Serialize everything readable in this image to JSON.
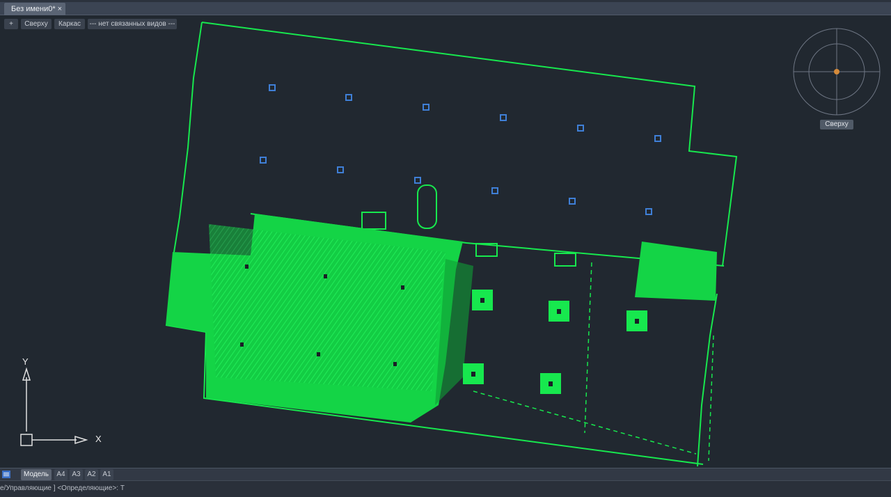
{
  "app": {
    "document_tab": {
      "title": "Без имени0*",
      "close_glyph": "×"
    }
  },
  "viewport": {
    "controls": {
      "menu_glyph": "+",
      "view": "Сверху",
      "visual_style": "Каркас",
      "named_views": "--- нет связанных видов ---"
    },
    "navigation_cube": {
      "label": "Сверху"
    },
    "ucs": {
      "x_label": "X",
      "y_label": "Y"
    }
  },
  "layout_tabs": [
    {
      "label": "Модель",
      "active": true
    },
    {
      "label": "A4",
      "active": false
    },
    {
      "label": "A3",
      "active": false
    },
    {
      "label": "A2",
      "active": false
    },
    {
      "label": "A1",
      "active": false
    }
  ],
  "command_line": {
    "text": "е/Управляющие ] <Определяющие>: Т"
  },
  "colors": {
    "background": "#212830",
    "point_cloud_green": "#17e84e",
    "marker_blue": "#3f7fd6",
    "cube_center": "#d58a3a"
  }
}
